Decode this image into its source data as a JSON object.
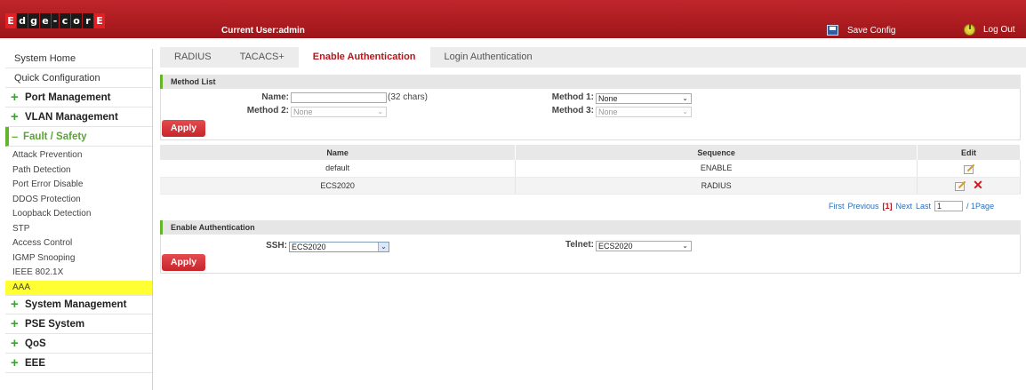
{
  "header": {
    "logo_letters": [
      "E",
      "d",
      "g",
      "e",
      "-",
      "c",
      "o",
      "r",
      "E"
    ],
    "current_user": "Current User:admin",
    "save_config": "Save Config",
    "log_out": "Log Out"
  },
  "sidebar": {
    "system_home": "System Home",
    "quick_config": "Quick Configuration",
    "port_management": "Port Management",
    "vlan_management": "VLAN Management",
    "fault_safety": "Fault / Safety",
    "fault_items": [
      "Attack Prevention",
      "Path Detection",
      "Port Error Disable",
      "DDOS Protection",
      "Loopback Detection",
      "STP",
      "Access Control",
      "IGMP Snooping",
      "IEEE 802.1X",
      "AAA"
    ],
    "system_management": "System Management",
    "pse_system": "PSE System",
    "qos": "QoS",
    "eee": "EEE"
  },
  "tabs": [
    "RADIUS",
    "TACACS+",
    "Enable Authentication",
    "Login Authentication"
  ],
  "method_list": {
    "title": "Method List",
    "name_label": "Name:",
    "name_value": "",
    "name_hint": "(32 chars)",
    "method1_label": "Method 1:",
    "method1_value": "None",
    "method2_label": "Method 2:",
    "method2_value": "None",
    "method3_label": "Method 3:",
    "method3_value": "None",
    "apply": "Apply"
  },
  "table": {
    "headers": [
      "Name",
      "Sequence",
      "Edit"
    ],
    "rows": [
      {
        "name": "default",
        "sequence": "ENABLE"
      },
      {
        "name": "ECS2020",
        "sequence": "RADIUS"
      }
    ]
  },
  "pager": {
    "first": "First",
    "previous": "Previous",
    "current": "[1]",
    "next": "Next",
    "last": "Last",
    "page_input": "1",
    "total": "/ 1Page"
  },
  "enable_auth": {
    "title": "Enable Authentication",
    "ssh_label": "SSH:",
    "ssh_value": "ECS2020",
    "telnet_label": "Telnet:",
    "telnet_value": "ECS2020",
    "apply": "Apply"
  },
  "colors": {
    "brand_red": "#b4171c",
    "accent_green": "#65b52a",
    "highlight_yellow": "#ffff33"
  }
}
